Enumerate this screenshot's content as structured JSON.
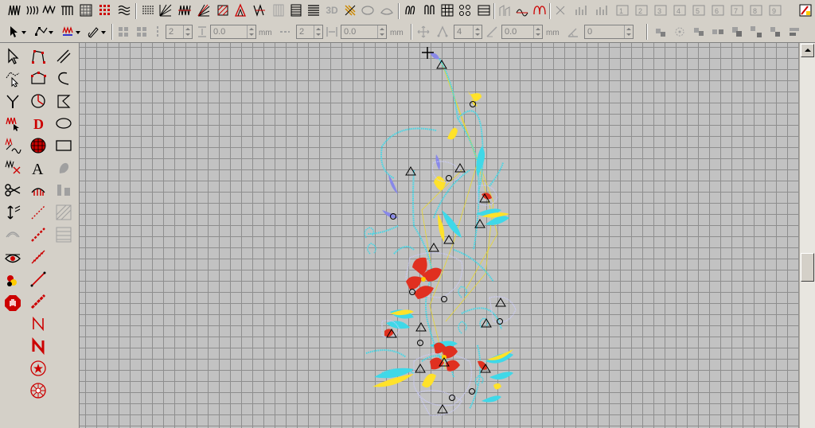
{
  "toolbar_top": {
    "label_3d": "3D",
    "icons": [
      "satin-stitch-icon",
      "tatami-stitch-icon",
      "zigzag-stitch-icon",
      "column-stitch-icon",
      "pattern-fill-icon",
      "cross-stitch-icon",
      "wave-fill-icon",
      "run-stitch-icon",
      "radial-fill-icon",
      "motif-stitch-icon",
      "star-fill-icon",
      "contour-fill-icon",
      "spiral-fill-icon",
      "carved-fill-icon",
      "flexi-split-icon",
      "stipple-icon",
      "lines-icon",
      "3d-icon",
      "raised-satin-icon",
      "applique-icon",
      "appliqué-cut-icon",
      "puffy-icon",
      "columns-icon",
      "grid-fill-icon",
      "ripple-fill-icon",
      "loop-icon",
      "pattern-run-icon",
      "order-icon",
      "object-a-icon",
      "object-b-icon",
      "object-c-icon",
      "object-d-icon",
      "object-e-icon",
      "object-f-icon",
      "object-g-icon",
      "object-h-icon",
      "object-i-icon",
      "color-palette-icon"
    ]
  },
  "toolbar_second": {
    "fields": [
      {
        "name": "rows-count",
        "value": "2"
      },
      {
        "name": "row-spacing",
        "value": "0.0"
      },
      {
        "name": "cols-count",
        "value": "2"
      },
      {
        "name": "col-spacing",
        "value": "0.0"
      },
      {
        "name": "points-count",
        "value": "4"
      },
      {
        "name": "point-spacing",
        "value": "0.0"
      },
      {
        "name": "rotation-angle",
        "value": "0"
      }
    ],
    "unit_mm": "mm"
  },
  "colors": {
    "toolbar_bg": "#d4d0c8",
    "canvas_bg": "#c2c2c2",
    "grid_line": "#8e8e8e",
    "stitch_cyan": "#3fd8e8",
    "stitch_yellow": "#ffe22a",
    "stitch_red": "#e03020",
    "stitch_violet": "#8888e8",
    "accent_red": "#cc0000"
  }
}
